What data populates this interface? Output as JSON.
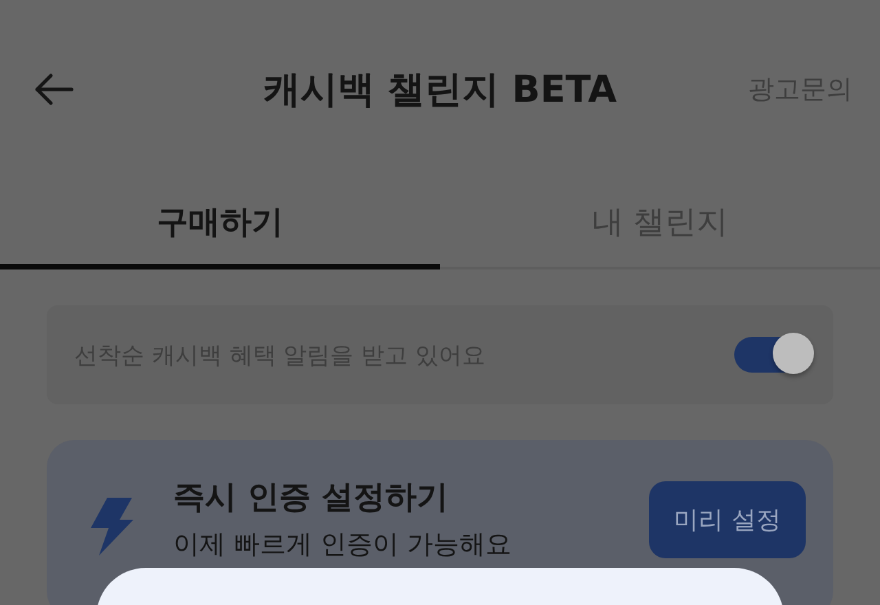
{
  "header": {
    "title": "캐시백 챌린지 BETA",
    "action": "광고문의"
  },
  "tabs": [
    {
      "label": "구매하기",
      "selected": true
    },
    {
      "label": "내 챌린지",
      "selected": false
    }
  ],
  "notice": {
    "text": "선착순 캐시백 혜택 알림을 받고 있어요",
    "on": true
  },
  "card": {
    "title": "즉시 인증 설정하기",
    "subtitle": "이제 빠르게 인증이 가능해요",
    "button": "미리 설정"
  }
}
